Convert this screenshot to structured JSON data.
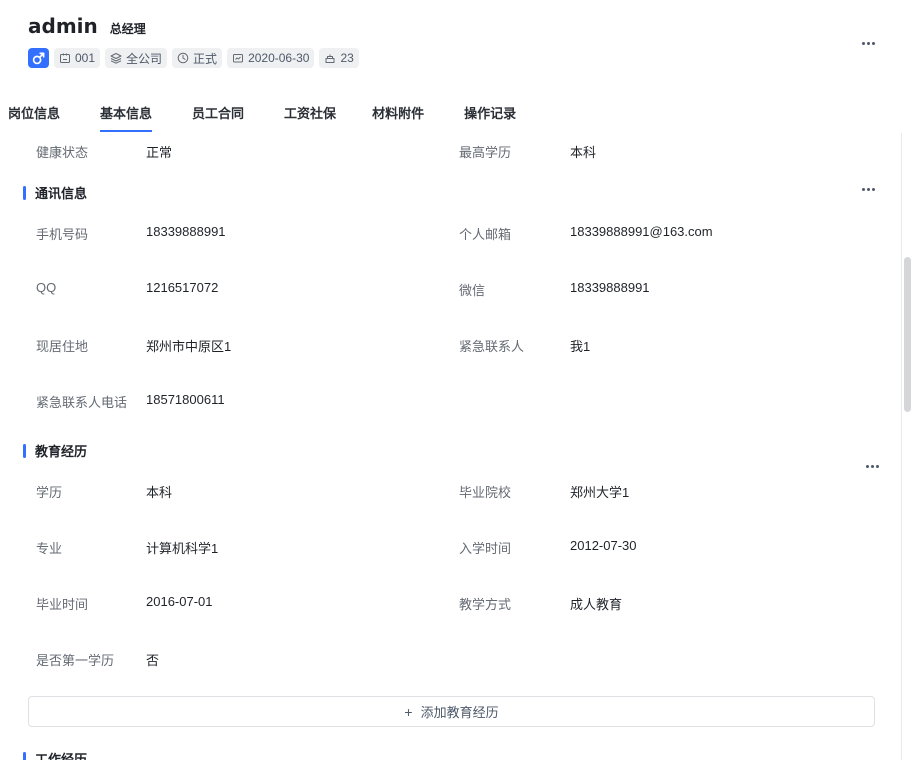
{
  "header": {
    "name": "admin",
    "role": "总经理",
    "tags": [
      {
        "icon": "badge-icon",
        "text": "001"
      },
      {
        "icon": "layers-icon",
        "text": "全公司"
      },
      {
        "icon": "clock-icon",
        "text": "正式"
      },
      {
        "icon": "calendar-icon",
        "text": "2020-06-30"
      },
      {
        "icon": "cake-icon",
        "text": "23"
      }
    ]
  },
  "tabs": [
    {
      "label": "岗位信息",
      "active": false
    },
    {
      "label": "基本信息",
      "active": true
    },
    {
      "label": "员工合同",
      "active": false
    },
    {
      "label": "工资社保",
      "active": false
    },
    {
      "label": "材料附件",
      "active": false
    },
    {
      "label": "操作记录",
      "active": false
    }
  ],
  "basic": {
    "health_label": "健康状态",
    "health_value": "正常",
    "education_label": "最高学历",
    "education_value": "本科"
  },
  "contact": {
    "title": "通讯信息",
    "phone_label": "手机号码",
    "phone_value": "18339888991",
    "email_label": "个人邮箱",
    "email_value": "18339888991@163.com",
    "qq_label": "QQ",
    "qq_value": "1216517072",
    "wechat_label": "微信",
    "wechat_value": "18339888991",
    "address_label": "现居住地",
    "address_value": "郑州市中原区1",
    "emergency_label": "紧急联系人",
    "emergency_value": "我1",
    "emergency_phone_label": "紧急联系人电话",
    "emergency_phone_value": "18571800611"
  },
  "education": {
    "title": "教育经历",
    "degree_label": "学历",
    "degree_value": "本科",
    "school_label": "毕业院校",
    "school_value": "郑州大学1",
    "major_label": "专业",
    "major_value": "计算机科学1",
    "enroll_label": "入学时间",
    "enroll_value": "2012-07-30",
    "graduate_label": "毕业时间",
    "graduate_value": "2016-07-01",
    "mode_label": "教学方式",
    "mode_value": "成人教育",
    "first_label": "是否第一学历",
    "first_value": "否",
    "add_label": "添加教育经历"
  },
  "work": {
    "title": "工作经历"
  },
  "colors": {
    "accent": "#3370ff",
    "label": "#646a73",
    "text": "#1f2329",
    "tag_bg": "#eff0f2"
  }
}
